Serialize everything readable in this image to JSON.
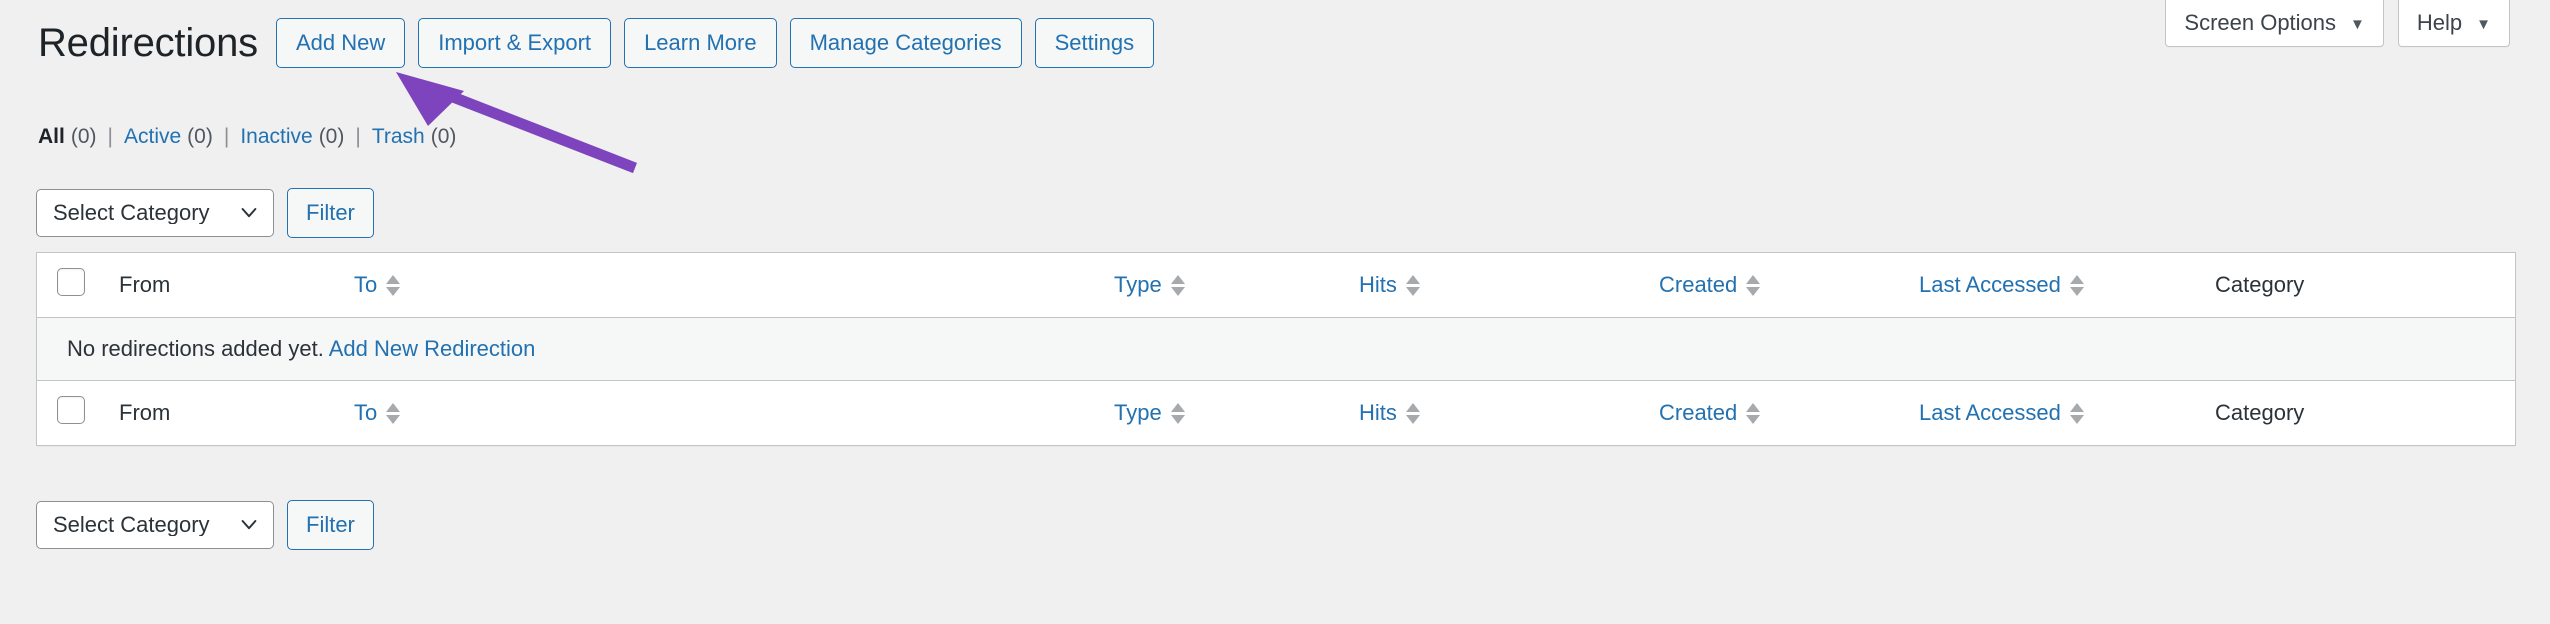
{
  "screen_meta": {
    "screen_options_label": "Screen Options",
    "help_label": "Help",
    "caret_glyph": "▼"
  },
  "header": {
    "title": "Redirections",
    "actions": [
      {
        "label": "Add New",
        "name": "add-new-button"
      },
      {
        "label": "Import & Export",
        "name": "import-export-button"
      },
      {
        "label": "Learn More",
        "name": "learn-more-button"
      },
      {
        "label": "Manage Categories",
        "name": "manage-categories-button"
      },
      {
        "label": "Settings",
        "name": "settings-button"
      }
    ]
  },
  "status_filters": {
    "separator": "|",
    "items": [
      {
        "label": "All",
        "count": "(0)",
        "current": true
      },
      {
        "label": "Active",
        "count": "(0)",
        "current": false
      },
      {
        "label": "Inactive",
        "count": "(0)",
        "current": false
      },
      {
        "label": "Trash",
        "count": "(0)",
        "current": false
      }
    ]
  },
  "tablenav": {
    "category_selected": "Select Category",
    "category_options": [
      "Select Category"
    ],
    "filter_label": "Filter"
  },
  "table": {
    "columns": [
      {
        "label": "From",
        "sortable": false
      },
      {
        "label": "To",
        "sortable": true
      },
      {
        "label": "Type",
        "sortable": true
      },
      {
        "label": "Hits",
        "sortable": true
      },
      {
        "label": "Created",
        "sortable": true
      },
      {
        "label": "Last Accessed",
        "sortable": true
      },
      {
        "label": "Category",
        "sortable": false
      }
    ],
    "empty_message": "No redirections added yet.",
    "empty_link": "Add New Redirection"
  },
  "colors": {
    "accent_link": "#2271b1",
    "page_background": "#f0f0f1",
    "border": "#c3c4c7",
    "annotation_purple": "#7e44bd"
  }
}
